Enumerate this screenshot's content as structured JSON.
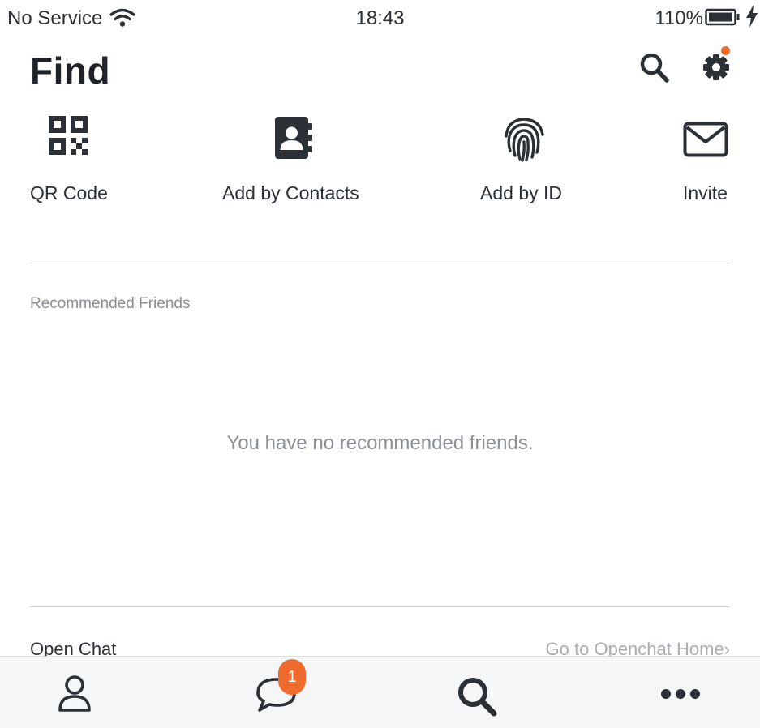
{
  "status_bar": {
    "carrier": "No Service",
    "time": "18:43",
    "battery": "110%"
  },
  "header": {
    "title": "Find",
    "search_icon": "search-icon",
    "settings_icon": "gear-icon",
    "settings_has_notification": true
  },
  "actions": [
    {
      "label": "QR Code",
      "icon": "qr-code-icon"
    },
    {
      "label": "Add by Contacts",
      "icon": "contact-book-icon"
    },
    {
      "label": "Add by ID",
      "icon": "fingerprint-icon"
    },
    {
      "label": "Invite",
      "icon": "envelope-icon"
    }
  ],
  "recommended": {
    "section_label": "Recommended Friends",
    "empty_message": "You have no recommended friends."
  },
  "openchat": {
    "label": "Open Chat",
    "link": "Go to Openchat Home"
  },
  "tab_bar": {
    "tabs": [
      {
        "name": "friends",
        "icon": "person-icon"
      },
      {
        "name": "chats",
        "icon": "chat-bubble-icon",
        "badge": "1"
      },
      {
        "name": "find",
        "icon": "search-icon",
        "active": true
      },
      {
        "name": "more",
        "icon": "more-dots-icon"
      }
    ]
  },
  "colors": {
    "text": "#2b2f36",
    "muted": "#8a8f96",
    "accent": "#ef6a2d",
    "divider": "#d0d3d8",
    "tab_bar_bg": "#f5f6f8"
  }
}
